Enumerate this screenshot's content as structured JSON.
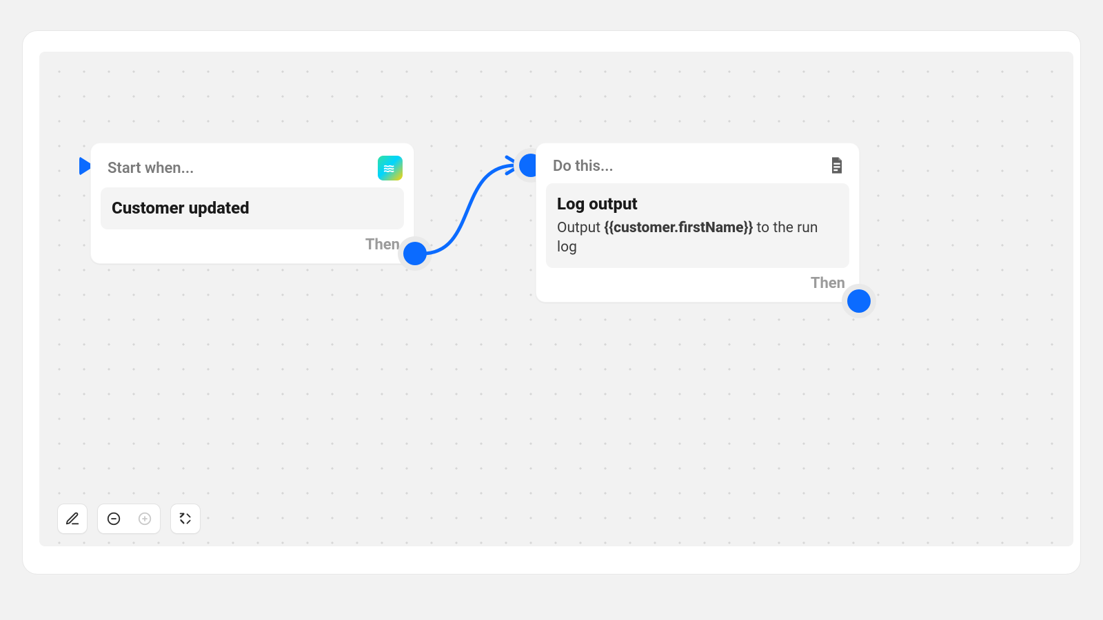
{
  "colors": {
    "accent": "#0b6bff",
    "pageBg": "#f2f2f2",
    "cardBg": "#ffffff"
  },
  "nodes": {
    "trigger": {
      "header": "Start when...",
      "body_title": "Customer updated",
      "footer": "Then",
      "icon_name": "flow-app-icon"
    },
    "action": {
      "header": "Do this...",
      "body_title": "Log output",
      "body_prefix": "Output ",
      "body_variable": "{{customer.firstName}}",
      "body_suffix": " to the run log",
      "footer": "Then",
      "icon_name": "document-icon"
    }
  },
  "toolbar": {
    "edit": "edit",
    "zoom_out": "zoom-out",
    "zoom_in": "zoom-in",
    "zoom_in_disabled": true,
    "fit": "fit-view"
  }
}
